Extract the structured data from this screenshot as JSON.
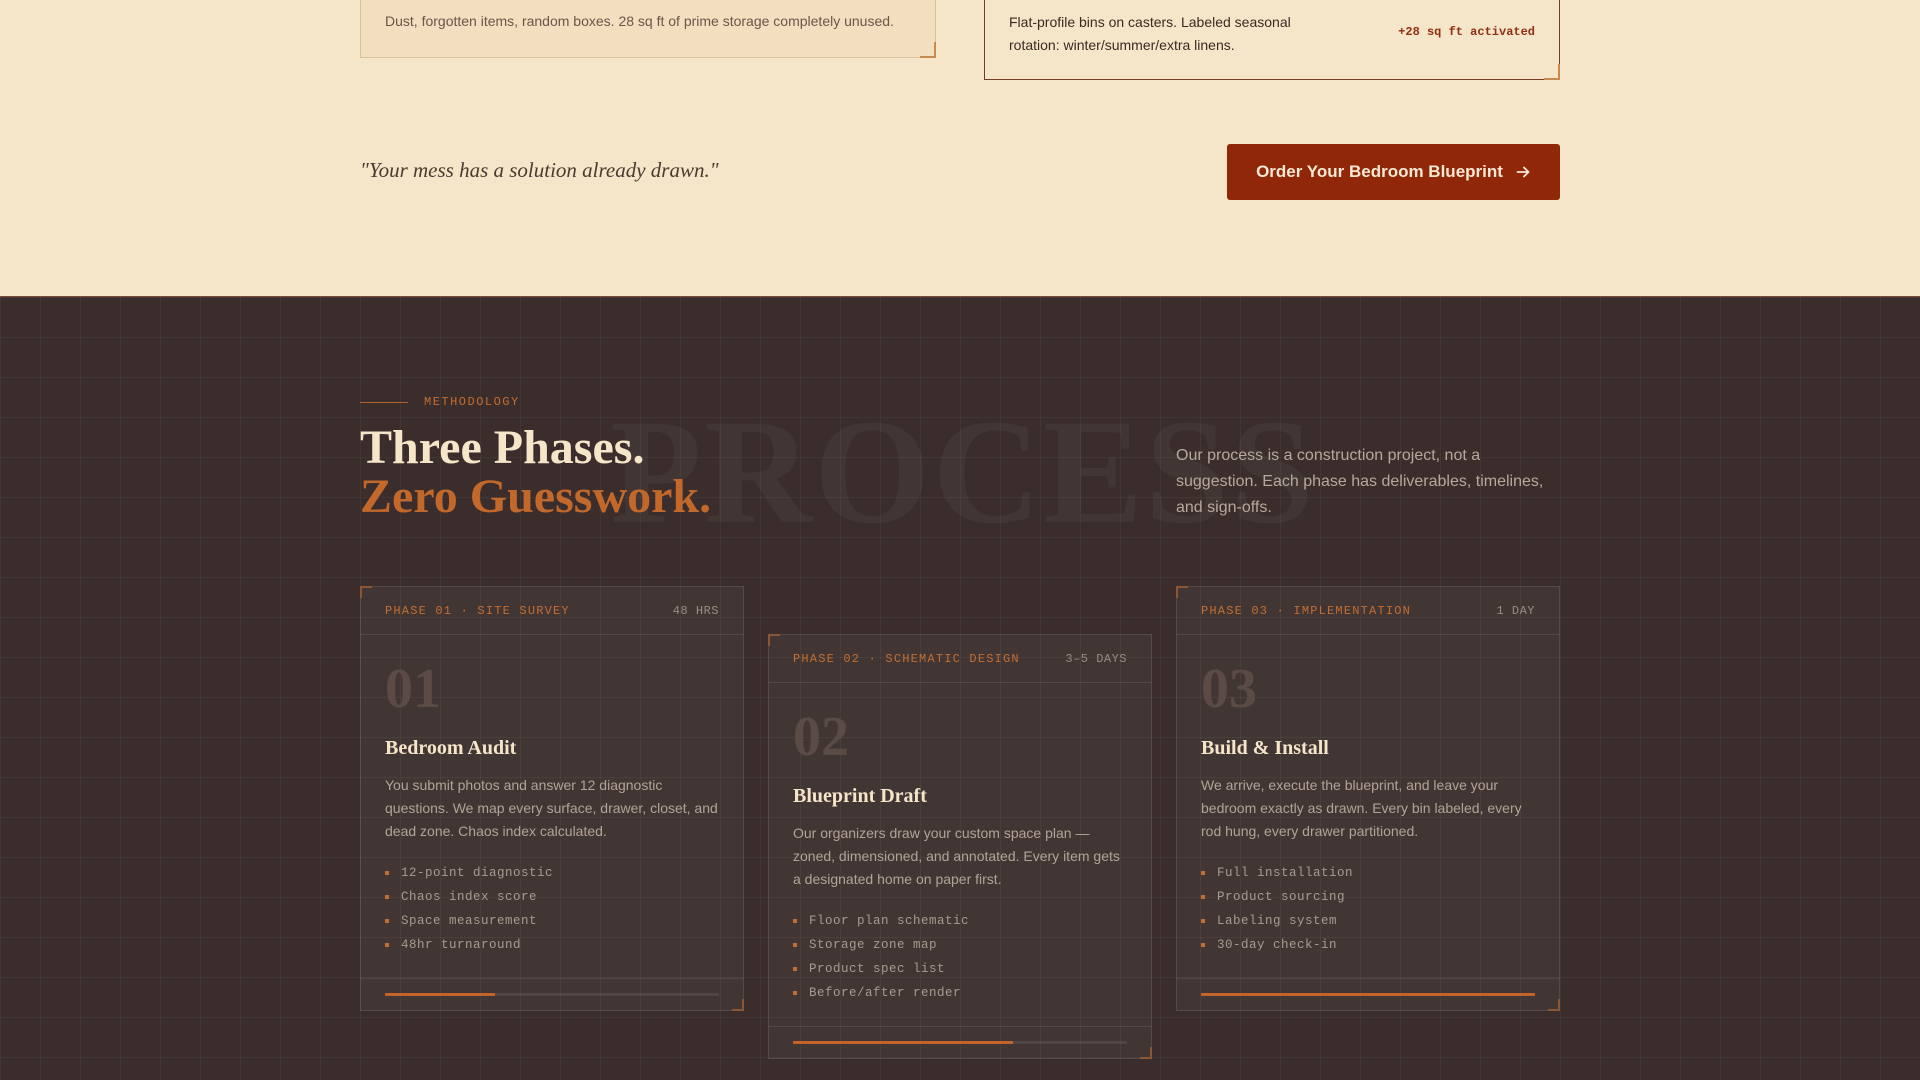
{
  "comparison": {
    "before_text": "Dust, forgotten items, random boxes. 28 sq ft of prime storage completely unused.",
    "after_text": "Flat-profile bins on casters. Labeled seasonal rotation: winter/summer/extra linens.",
    "after_delta": "+28 sq ft activated"
  },
  "cta_row": {
    "quote": "\"Your mess has a solution already drawn.\"",
    "button_label": "Order Your Bedroom Blueprint",
    "button_icon": "arrow-right-icon"
  },
  "methodology": {
    "eyebrow": "METHODOLOGY",
    "ghost_word": "PROCESS",
    "title_line1": "Three Phases.",
    "title_line2": "Zero Guesswork.",
    "intro": "Our process is a construction project, not a suggestion. Each phase has deliverables, timelines, and sign-offs."
  },
  "phases": [
    {
      "code": "PHASE 01 · SITE SURVEY",
      "duration": "48 HRS",
      "number": "01",
      "name": "Bedroom Audit",
      "description": "You submit photos and answer 12 diagnostic questions. We map every surface, drawer, closet, and dead zone. Chaos index calculated.",
      "items": [
        "12-point diagnostic",
        "Chaos index score",
        "Space measurement",
        "48hr turnaround"
      ],
      "progress": 0.33
    },
    {
      "code": "PHASE 02 · SCHEMATIC DESIGN",
      "duration": "3–5 DAYS",
      "number": "02",
      "name": "Blueprint Draft",
      "description": "Our organizers draw your custom space plan — zoned, dimensioned, and annotated. Every item gets a designated home on paper first.",
      "items": [
        "Floor plan schematic",
        "Storage zone map",
        "Product spec list",
        "Before/after render"
      ],
      "progress": 0.66
    },
    {
      "code": "PHASE 03 · IMPLEMENTATION",
      "duration": "1 DAY",
      "number": "03",
      "name": "Build & Install",
      "description": "We arrive, execute the blueprint, and leave your bedroom exactly as drawn. Every bin labeled, every rod hung, every drawer partitioned.",
      "items": [
        "Full installation",
        "Product sourcing",
        "Labeling system",
        "30-day check-in"
      ],
      "progress": 1.0
    }
  ],
  "colors": {
    "accent": "#c4642b",
    "cta": "#8f2708",
    "dark_bg": "#3a2d2c",
    "cream_bg": "#f6e6c9"
  }
}
